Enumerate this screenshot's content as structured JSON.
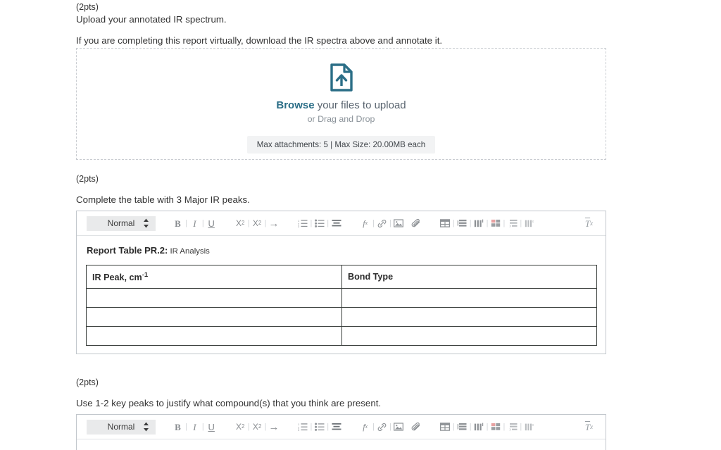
{
  "questions": [
    {
      "points": "(2pts)",
      "prompt": "Upload your annotated IR spectrum.",
      "note": "If you are completing this report virtually, download the IR spectra above and annotate it."
    },
    {
      "points": "(2pts)",
      "prompt": "Complete the table with 3 Major IR peaks."
    },
    {
      "points": "(2pts)",
      "prompt": "Use 1-2 key peaks to justify what compound(s) that you think are present."
    }
  ],
  "dropzone": {
    "icon": "file-upload-icon",
    "browse_label": "Browse",
    "browse_suffix": " your files to upload",
    "drag_label": "or Drag and Drop",
    "limits_label": "Max attachments: 5 | Max Size: 20.00MB each",
    "accent_color": "#2b6e87"
  },
  "toolbar": {
    "style_select_value": "Normal",
    "buttons": [
      {
        "name": "bold-icon",
        "label": "B"
      },
      {
        "name": "italic-icon",
        "label": "I"
      },
      {
        "name": "underline-icon",
        "label": "U"
      },
      {
        "name": "subscript-icon",
        "label": "X₂"
      },
      {
        "name": "superscript-icon",
        "label": "X²"
      },
      {
        "name": "indent-arrow-icon",
        "label": "→"
      },
      {
        "name": "numbered-list-icon",
        "label": ""
      },
      {
        "name": "bulleted-list-icon",
        "label": ""
      },
      {
        "name": "align-icon",
        "label": ""
      },
      {
        "name": "formula-icon",
        "label": "fx"
      },
      {
        "name": "link-icon",
        "label": ""
      },
      {
        "name": "image-icon",
        "label": ""
      },
      {
        "name": "attachment-icon",
        "label": ""
      },
      {
        "name": "insert-table-icon",
        "label": ""
      },
      {
        "name": "table-row-properties-icon",
        "label": ""
      },
      {
        "name": "table-column-properties-icon",
        "label": ""
      },
      {
        "name": "table-cell-properties-icon",
        "label": ""
      },
      {
        "name": "delete-row-icon",
        "label": ""
      },
      {
        "name": "delete-column-icon",
        "label": ""
      },
      {
        "name": "clear-formatting-icon",
        "label": "Tx"
      }
    ]
  },
  "report_table": {
    "caption_bold": "Report Table PR.2:",
    "caption_rest": " IR Analysis",
    "columns": [
      "IR Peak, cm",
      "Bond Type"
    ],
    "col1_superscript": "-1",
    "rows": [
      [
        "",
        ""
      ],
      [
        "",
        ""
      ],
      [
        "",
        ""
      ]
    ]
  }
}
